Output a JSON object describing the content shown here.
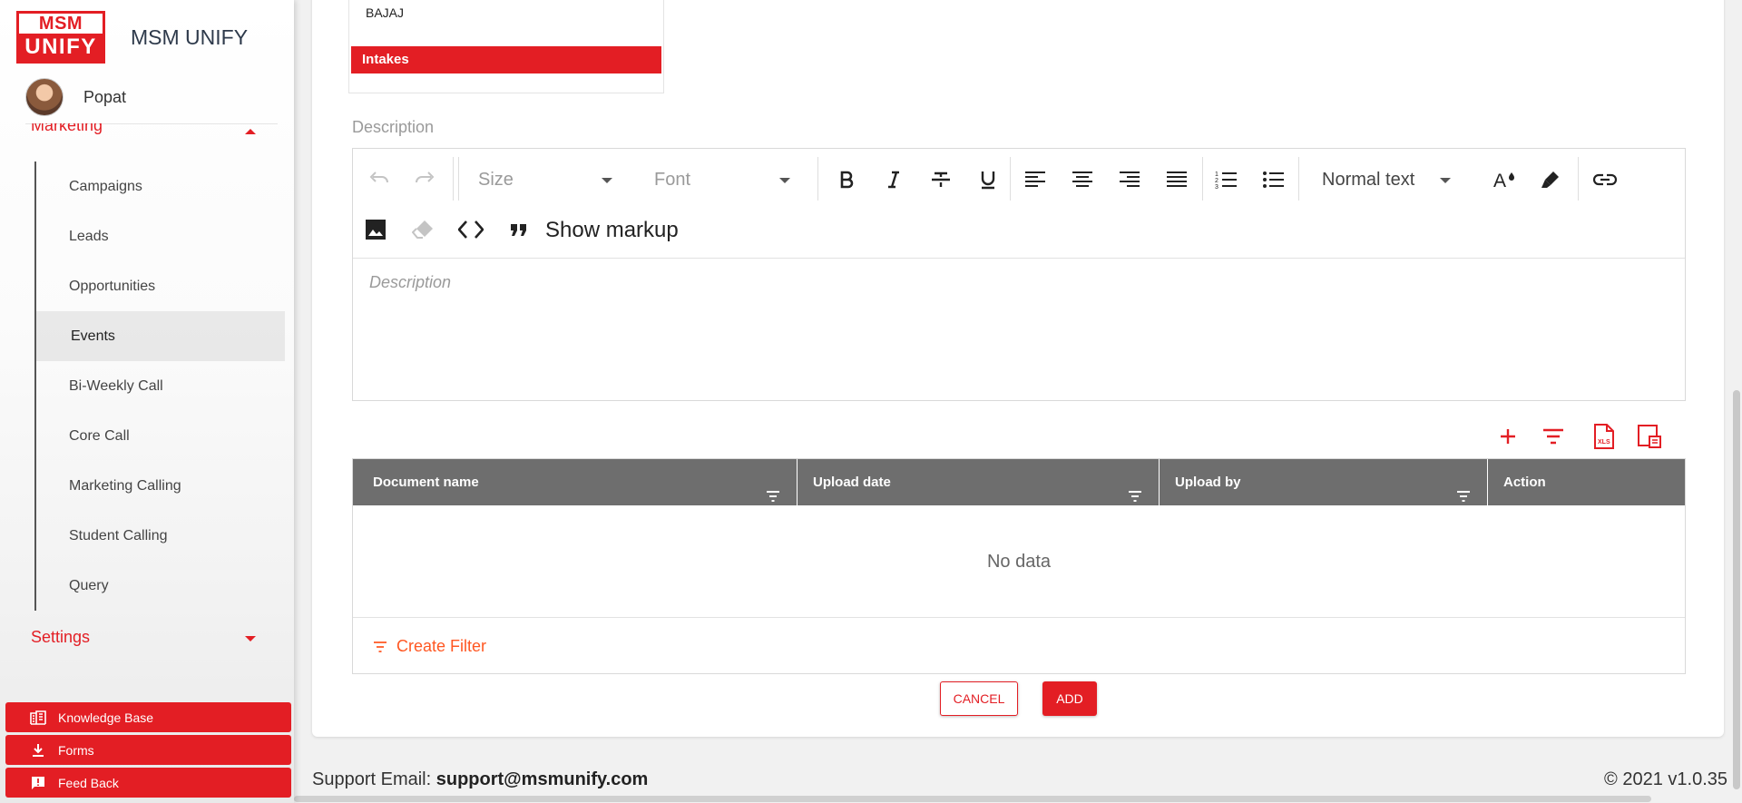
{
  "brand": {
    "logo_top": "MSM",
    "logo_bottom": "UNIFY",
    "name": "MSM UNIFY"
  },
  "user": {
    "name": "Popat"
  },
  "sidebar": {
    "marketing_label": "Marketing",
    "items": [
      {
        "label": "Campaigns"
      },
      {
        "label": "Leads"
      },
      {
        "label": "Opportunities"
      },
      {
        "label": "Events",
        "active": true
      },
      {
        "label": "Bi-Weekly Call"
      },
      {
        "label": "Core Call"
      },
      {
        "label": "Marketing Calling"
      },
      {
        "label": "Student Calling"
      },
      {
        "label": "Query"
      }
    ],
    "settings_label": "Settings",
    "buttons": {
      "knowledge_base": "Knowledge Base",
      "forms": "Forms",
      "feedback": "Feed Back"
    }
  },
  "listbox": {
    "option": "BAJAJ",
    "group_header": "Intakes"
  },
  "description": {
    "label": "Description",
    "placeholder": "Description",
    "toolbar": {
      "size_label": "Size",
      "font_label": "Font",
      "block_label": "Normal text",
      "show_markup": "Show markup"
    }
  },
  "documents": {
    "columns": [
      "Document name",
      "Upload date",
      "Upload by",
      "Action"
    ],
    "empty_text": "No data",
    "create_filter": "Create Filter"
  },
  "actions": {
    "cancel": "CANCEL",
    "add": "ADD"
  },
  "footer": {
    "support_prefix": "Support Email: ",
    "support_email": "support@msmunify.com",
    "version": "© 2021 v1.0.35"
  },
  "colors": {
    "brand_red": "#e31e24",
    "header_gray": "#6e6e6e",
    "filter_orange": "#ff5722"
  }
}
